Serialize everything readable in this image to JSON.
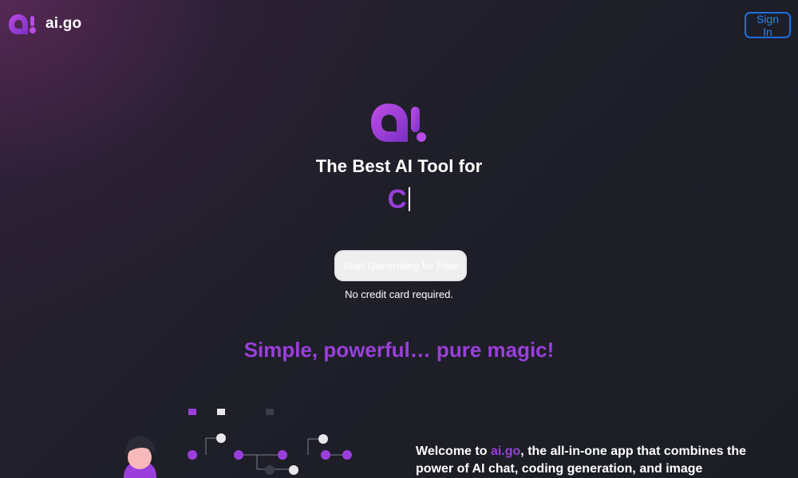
{
  "header": {
    "brand_name": "ai.go",
    "signin_label": "Sign In"
  },
  "hero": {
    "title": "The Best AI Tool for",
    "typed_text": "C",
    "cta_label": "Start Generating for Free",
    "note": "No credit card required."
  },
  "tagline": "Simple, powerful… pure magic!",
  "welcome": {
    "prefix": "Welcome to ",
    "brand": "ai.go",
    "suffix": ", the all-in-one app that combines the power of AI chat, coding generation, and image"
  },
  "icons": {
    "brand_logo": "ai-logo-icon",
    "hero_logo": "ai-logo-icon"
  },
  "colors": {
    "accent": "#9b3fdc",
    "signin_border": "#1d6fe0",
    "background": "#1b1d24"
  }
}
